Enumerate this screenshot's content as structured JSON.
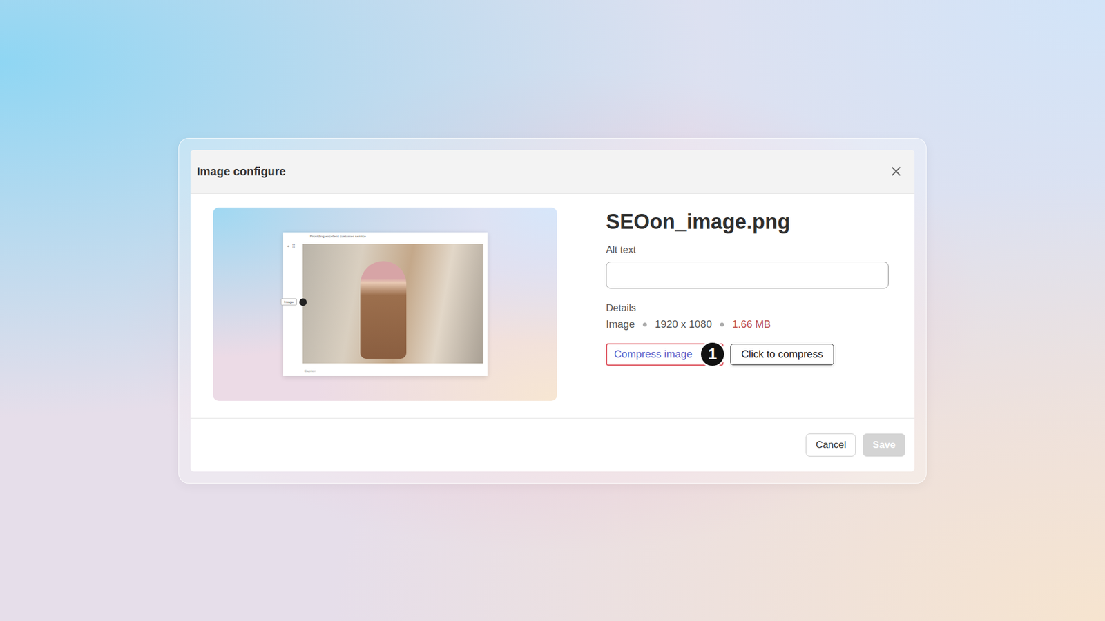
{
  "window": {
    "title": "Image configure"
  },
  "preview": {
    "headline": "Providing excellent customer service",
    "tag": "Image",
    "caption": "Caption",
    "handle_icons": [
      "+",
      "⠿"
    ]
  },
  "file": {
    "name": "SEOon_image.png"
  },
  "alt_text": {
    "label": "Alt text",
    "value": ""
  },
  "details": {
    "label": "Details",
    "items": [
      {
        "text": "Image",
        "warning": false
      },
      {
        "text": "1920 x 1080",
        "warning": false
      },
      {
        "text": "1.66 MB",
        "warning": true
      }
    ]
  },
  "compress": {
    "link": "Compress image",
    "highlighted": true,
    "step": "1",
    "tooltip": "Click to compress"
  },
  "buttons": [
    {
      "label": "Cancel",
      "disabled": false,
      "primary": false
    },
    {
      "label": "Save",
      "disabled": true,
      "primary": true
    }
  ]
}
